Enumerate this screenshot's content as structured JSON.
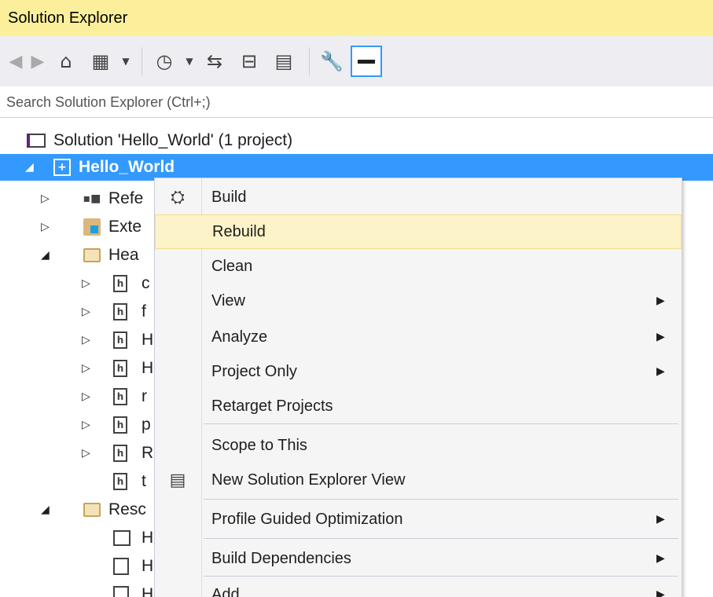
{
  "window": {
    "title": "Solution Explorer"
  },
  "toolbar": {
    "icons": [
      "back-icon",
      "forward-icon",
      "home-icon",
      "switch-views-icon",
      "pending-changes-filter-icon",
      "sync-active-document-icon",
      "collapse-all-icon",
      "show-all-files-icon",
      "properties-icon",
      "preview-selected-items-icon"
    ]
  },
  "search": {
    "placeholder": "Search Solution Explorer (Ctrl+;)"
  },
  "tree": {
    "solution": "Solution 'Hello_World' (1 project)",
    "project": "Hello_World",
    "references": "Refe",
    "external": "Exte",
    "headers": "Hea",
    "header_files": [
      "c",
      "f",
      "H",
      "H",
      "r",
      "p",
      "R",
      "t"
    ],
    "resources": "Resc",
    "resource_files": [
      "H",
      "H",
      "H"
    ]
  },
  "context_menu": {
    "items": [
      {
        "label": "Build",
        "icon": "build-icon"
      },
      {
        "label": "Rebuild"
      },
      {
        "label": "Clean"
      },
      {
        "label": "View",
        "submenu": true
      },
      {
        "label": "Analyze",
        "submenu": true
      },
      {
        "label": "Project Only",
        "submenu": true
      },
      {
        "label": "Retarget Projects"
      },
      {
        "label": "Scope to This"
      },
      {
        "label": "New Solution Explorer View",
        "icon": "new-solution-explorer-view-icon"
      },
      {
        "label": "Profile Guided Optimization",
        "submenu": true
      },
      {
        "label": "Build Dependencies",
        "submenu": true
      },
      {
        "label": "Add",
        "submenu": true
      }
    ],
    "hovered": "Rebuild"
  },
  "colors": {
    "title_bar": "#fcef9c",
    "selection": "#3399ff",
    "hover": "#fcf3c8"
  }
}
